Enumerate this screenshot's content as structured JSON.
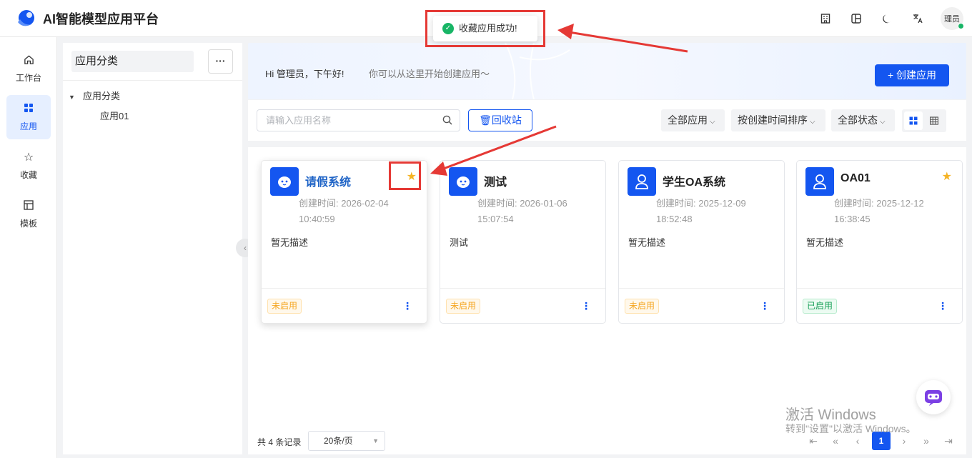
{
  "app": {
    "title": "AI智能模型应用平台"
  },
  "header": {
    "icons": [
      "building-icon",
      "layout-icon",
      "moon-icon",
      "translate-icon"
    ],
    "user_name": "理员"
  },
  "toast": {
    "message": "收藏应用成功!"
  },
  "nav": {
    "items": [
      {
        "label": "工作台",
        "icon": "home-icon",
        "active": false
      },
      {
        "label": "应用",
        "icon": "grid-icon",
        "active": true
      },
      {
        "label": "收藏",
        "icon": "star-icon",
        "active": false
      },
      {
        "label": "模板",
        "icon": "template-icon",
        "active": false
      }
    ]
  },
  "category": {
    "header": "应用分类",
    "more": "···",
    "tree_root": "应用分类",
    "tree_child": "应用01"
  },
  "banner": {
    "greeting": "Hi 管理员，下午好!",
    "sub": "你可以从这里开始创建应用〜",
    "create_label": "+ 创建应用"
  },
  "filters": {
    "search_placeholder": "请输入应用名称",
    "recycle_label": "回收站",
    "type": "全部应用",
    "sort": "按创建时间排序",
    "status": "全部状态"
  },
  "cards": [
    {
      "title": "请假系统",
      "icon": "robot-icon",
      "starred": true,
      "time1": "创建时间: 2026-02-04",
      "time2": "10:40:59",
      "desc": "暂无描述",
      "status": "未启用",
      "status_type": "off"
    },
    {
      "title": "测试",
      "icon": "robot-icon",
      "starred": false,
      "time1": "创建时间: 2026-01-06",
      "time2": "15:07:54",
      "desc": "测试",
      "status": "未启用",
      "status_type": "off"
    },
    {
      "title": "学生OA系统",
      "icon": "user-icon",
      "starred": false,
      "time1": "创建时间: 2025-12-09",
      "time2": "18:52:48",
      "desc": "暂无描述",
      "status": "未启用",
      "status_type": "off"
    },
    {
      "title": "OA01",
      "icon": "user-icon",
      "starred": true,
      "time1": "创建时间: 2025-12-12",
      "time2": "16:38:45",
      "desc": "暂无描述",
      "status": "已启用",
      "status_type": "on"
    }
  ],
  "pagination": {
    "total": "共 4 条记录",
    "page_size": "20条/页",
    "current": "1"
  },
  "watermark": {
    "line1": "激活 Windows",
    "line2": "转到\"设置\"以激活 Windows。"
  },
  "colors": {
    "primary": "#1456f0",
    "star": "#f5b324",
    "annotation": "#e53935"
  }
}
